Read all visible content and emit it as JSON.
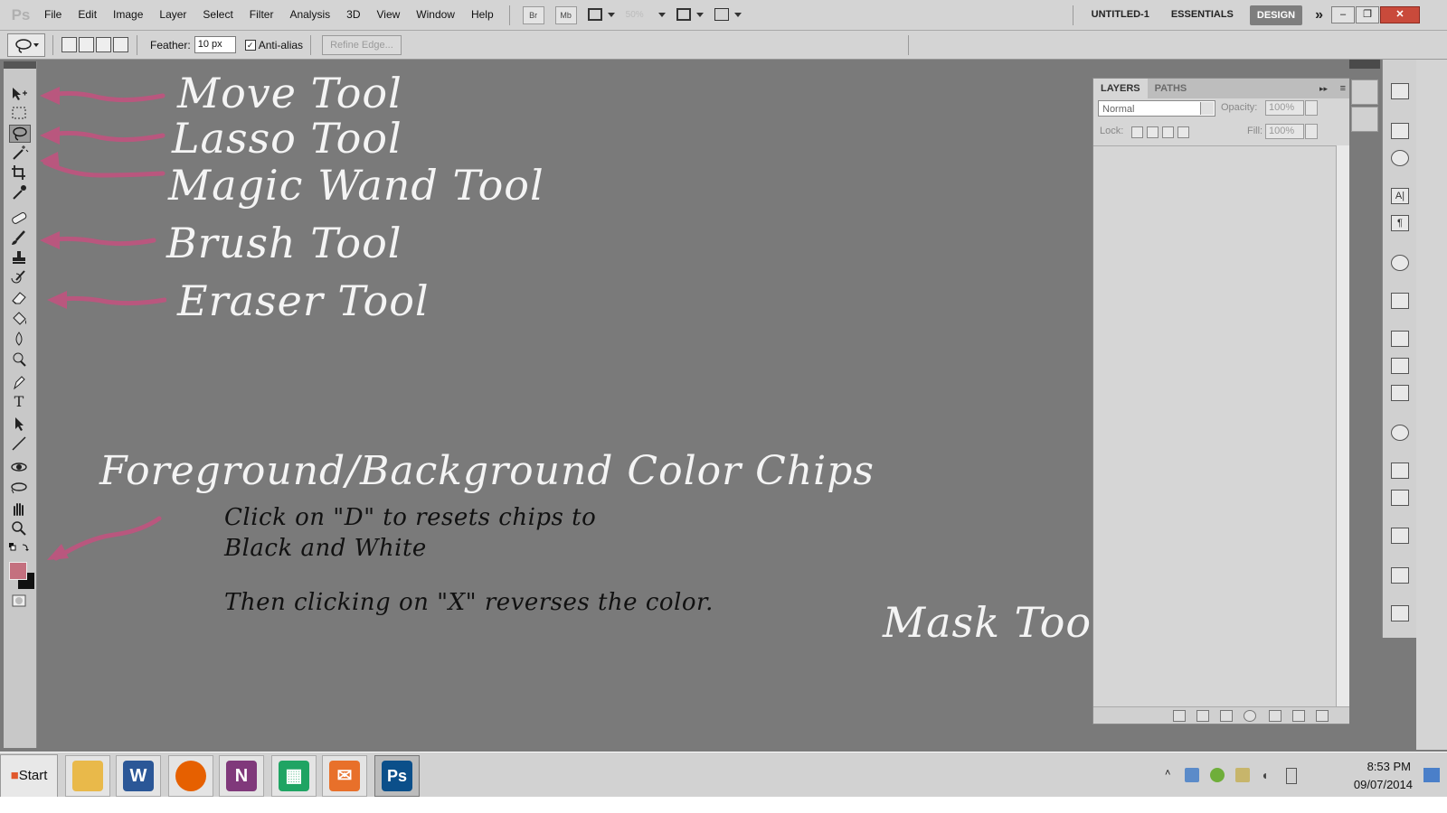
{
  "menubar": {
    "logo": "Ps",
    "items": [
      "File",
      "Edit",
      "Image",
      "Layer",
      "Select",
      "Filter",
      "Analysis",
      "3D",
      "View",
      "Window",
      "Help"
    ],
    "bridge_btn": "Br",
    "minibridge_btn": "Mb",
    "zoom_value": "50%",
    "document_title": "UNTITLED-1",
    "workspaces": [
      "ESSENTIALS",
      "DESIGN"
    ],
    "active_workspace": "DESIGN",
    "more_glyph": "»",
    "window_buttons": [
      "–",
      "❐",
      "✕"
    ]
  },
  "options_bar": {
    "feather_label": "Feather:",
    "feather_value": "10 px",
    "antialias_label": "Anti-alias",
    "antialias_checked": true,
    "refine_edge_label": "Refine Edge..."
  },
  "toolbox": {
    "tools": [
      "move-tool",
      "marquee-tool",
      "lasso-tool",
      "magic-wand-tool",
      "crop-tool",
      "eyedropper-tool",
      "spot-healing-tool",
      "brush-tool",
      "clone-stamp-tool",
      "history-brush-tool",
      "eraser-tool",
      "paint-bucket-tool",
      "blur-tool",
      "dodge-tool",
      "pen-tool",
      "type-tool",
      "path-selection-tool",
      "line-tool",
      "3d-rotate-tool",
      "3d-orbit-tool",
      "hand-tool",
      "zoom-tool"
    ],
    "type_tool_glyph": "T",
    "foreground_color": "#c4707f",
    "background_color": "#111111"
  },
  "annotations": {
    "move": "Move  Tool",
    "lasso": "Lasso  Tool",
    "magic_wand": "Magic  Wand  Tool",
    "brush": "Brush  Tool",
    "eraser": "Eraser  Tool",
    "chips_title": "Foreground/Background  Color  Chips",
    "chips_line1": "Click  on  \"D\"  to  resets  chips  to",
    "chips_line2": "Black  and  White",
    "chips_line3": "Then  clicking  on  \"X\"  reverses  the  color.",
    "mask": "Mask  Tool",
    "arrow_color": "#b9577e"
  },
  "layers_panel": {
    "tabs": [
      "LAYERS",
      "PATHS"
    ],
    "active_tab": "LAYERS",
    "blend_mode": "Normal",
    "opacity_label": "Opacity:",
    "opacity_value": "100%",
    "lock_label": "Lock:",
    "fill_label": "Fill:",
    "fill_value": "100%"
  },
  "dock": {
    "paragraph_glyph": "¶",
    "character_glyph": "A|"
  },
  "taskbar": {
    "start_label": "Start",
    "apps": [
      {
        "name": "file-explorer-icon",
        "glyph": "",
        "color": "#e9b94a"
      },
      {
        "name": "word-icon",
        "glyph": "W",
        "color": "#2b5797"
      },
      {
        "name": "firefox-icon",
        "glyph": "",
        "color": "#e66000"
      },
      {
        "name": "onenote-icon",
        "glyph": "N",
        "color": "#80397b"
      },
      {
        "name": "sheets-icon",
        "glyph": "▦",
        "color": "#1fa463"
      },
      {
        "name": "mail-icon",
        "glyph": "✉",
        "color": "#e8702a"
      },
      {
        "name": "photoshop-icon",
        "glyph": "Ps",
        "color": "#0b4f8a"
      }
    ],
    "clock_time": "8:53 PM",
    "clock_date": "09/07/2014"
  }
}
